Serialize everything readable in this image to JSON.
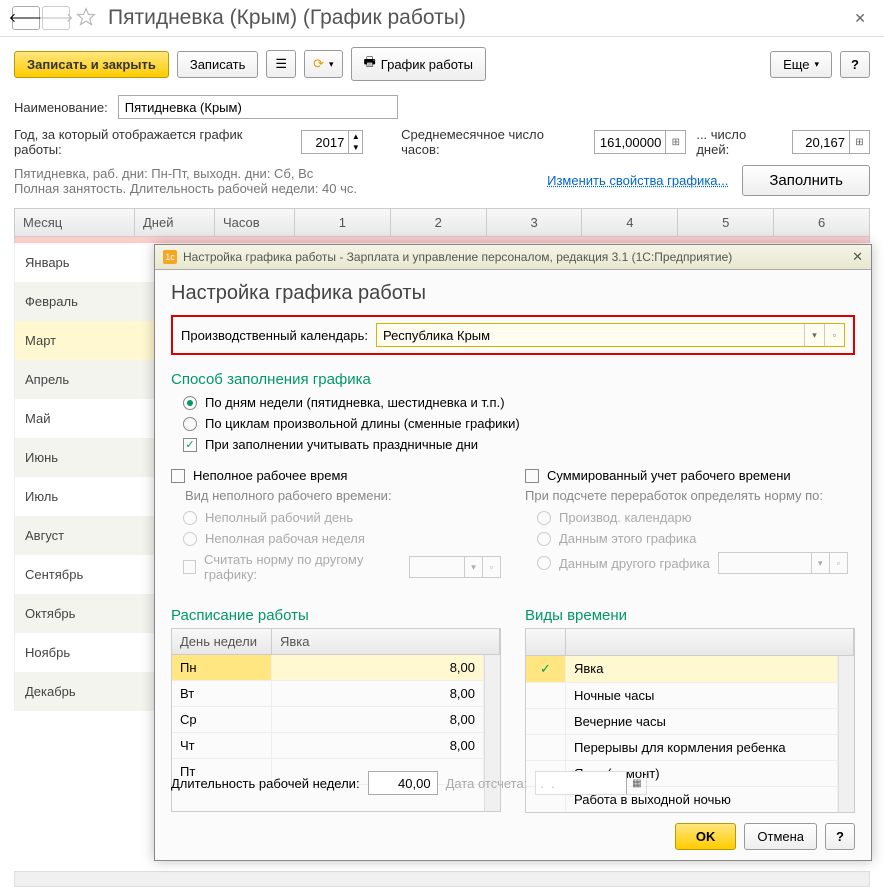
{
  "title": "Пятидневка (Крым) (График работы)",
  "toolbar": {
    "save_close": "Записать и закрыть",
    "save": "Записать",
    "print": "График работы",
    "more": "Еще",
    "help": "?"
  },
  "form": {
    "name_label": "Наименование:",
    "name_value": "Пятидневка (Крым)",
    "year_label": "Год, за который отображается график работы:",
    "year_value": "2017",
    "avg_hours_label": "Среднемесячное число часов:",
    "avg_hours_value": "161,00000",
    "days_label": "... число дней:",
    "days_value": "20,167"
  },
  "desc": {
    "line1": "Пятидневка, раб. дни: Пн-Пт, выходн. дни: Сб, Вс",
    "line2": "Полная занятость. Длительность рабочей недели: 40 чс.",
    "link": "Изменить свойства графика...",
    "fill": "Заполнить"
  },
  "grid": {
    "cols": [
      "Месяц",
      "Дней",
      "Часов",
      "1",
      "2",
      "3",
      "4",
      "5",
      "6"
    ],
    "months": [
      "Январь",
      "Февраль",
      "Март",
      "Апрель",
      "Май",
      "Июнь",
      "Июль",
      "Август",
      "Сентябрь",
      "Октябрь",
      "Ноябрь",
      "Декабрь"
    ]
  },
  "dialog": {
    "title": "Настройка графика работы - Зарплата и управление персоналом, редакция 3.1  (1С:Предприятие)",
    "h1": "Настройка графика работы",
    "calendar_label": "Производственный календарь:",
    "calendar_value": "Республика Крым",
    "method_h": "Способ заполнения графика",
    "opt1": "По дням недели (пятидневка, шестидневка и т.п.)",
    "opt2": "По циклам произвольной длины (сменные графики)",
    "opt3": "При заполнении учитывать праздничные дни",
    "parttime": "Неполное рабочее время",
    "parttime_kind": "Вид неполного рабочего времени:",
    "parttime_day": "Неполный рабочий день",
    "parttime_week": "Неполная рабочая неделя",
    "parttime_other": "Считать норму по другому графику:",
    "summed": "Суммированный учет рабочего времени",
    "overtime_label": "При подсчете переработок определять норму по:",
    "overtime_cal": "Производ. календарю",
    "overtime_this": "Данным этого графика",
    "overtime_other": "Данным другого графика",
    "schedule_h": "Расписание работы",
    "day_col": "День недели",
    "att_col": "Явка",
    "schedule": [
      {
        "day": "Пн",
        "val": "8,00"
      },
      {
        "day": "Вт",
        "val": "8,00"
      },
      {
        "day": "Ср",
        "val": "8,00"
      },
      {
        "day": "Чт",
        "val": "8,00"
      },
      {
        "day": "Пт",
        "val": ""
      }
    ],
    "types_h": "Виды времени",
    "types": [
      {
        "checked": true,
        "label": "Явка"
      },
      {
        "checked": false,
        "label": "Ночные часы"
      },
      {
        "checked": false,
        "label": "Вечерние часы"
      },
      {
        "checked": false,
        "label": "Перерывы для кормления ребенка"
      },
      {
        "checked": false,
        "label": "Явка (ремонт)"
      },
      {
        "checked": false,
        "label": "Работа в выходной ночью"
      }
    ],
    "week_len_label": "Длительность рабочей недели:",
    "week_len_value": "40,00",
    "start_date_label": "Дата отсчета:",
    "start_date_value": ".  .",
    "ok": "OK",
    "cancel": "Отмена",
    "help": "?"
  }
}
